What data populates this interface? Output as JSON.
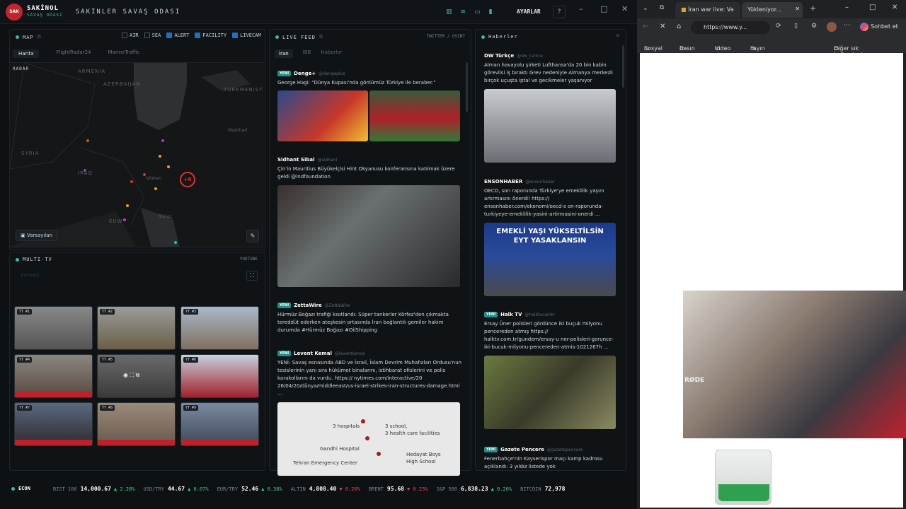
{
  "app": {
    "brand": "SAKİNOL",
    "brand_sub": "SAVAŞ ODASI",
    "logo_text": "SAKİNOL",
    "page_title": "SAKİNLER SAVAŞ ODASI",
    "settings_label": "AYARLAR",
    "help_label": "?"
  },
  "map_panel": {
    "title": "MAP",
    "filters": [
      {
        "label": "AIR",
        "checked": false
      },
      {
        "label": "SEA",
        "checked": false
      },
      {
        "label": "ALERT",
        "checked": true
      },
      {
        "label": "FACILITY",
        "checked": true
      },
      {
        "label": "LIVECAM",
        "checked": true
      }
    ],
    "tabs": [
      "Harita",
      "FlightRadar24",
      "MarineTraffic"
    ],
    "radar_label": "RADAR",
    "labels": [
      "ARMENIA",
      "AZERBAIJAN",
      "TURKMENIST",
      "SYRIA",
      "IRAQ",
      "Isfahan",
      "KUW",
      "Mashhad",
      "Shiraz"
    ],
    "marker_label": "+8",
    "preset_label": "Varsayılan"
  },
  "tv_panel": {
    "title": "MULTI-TV",
    "source": "YOUTUBE",
    "sub": "KAYNAK",
    "tiles": [
      "YT #1",
      "YT #2",
      "YT #3",
      "YT #4",
      "YT #5",
      "YT #6",
      "YT #7",
      "YT #8",
      "YT #9"
    ]
  },
  "feed_panel": {
    "title": "LIVE FEED",
    "source": "TWITTER / OSINT",
    "tabs": [
      "İran",
      "İBB",
      "Haberler"
    ],
    "posts": [
      {
        "name": "Denge+",
        "handle": "@dengeplus",
        "tag": "YENİ",
        "text": "George Hagi: \"Dünya Kupası'nda gönlümüz Türkiye ile beraber.\""
      },
      {
        "name": "Sidhant Sibal",
        "handle": "@sidhant",
        "tag": "",
        "text": "Çin'in Mauritius Büyükelçisi Hint Okyanusu konferansına katılmak üzere geldi @indfoundation"
      },
      {
        "name": "ZettaWire",
        "handle": "@ZettaWire",
        "tag": "YENİ",
        "text": "Hürmüz Boğazı trafiği kısıtlandı: Süper tankerler Körfez'den çıkmakta tereddüt ederken ateşkesin ortasında İran bağlantılı gemiler hakim durumda #Hürmüz Boğazı #OilShipping"
      },
      {
        "name": "Levent Kemal",
        "handle": "@leventkemal",
        "tag": "YENİ",
        "text": "YENİ: Savaş esnasında ABD ve İsrail, İslam Devrim Muhafızları Ordusu'nun tesislerinin yanı sıra hükümet binalarını, istihbarat ofislerini ve polis karakollarını da vurdu. https:// nytimes.com/interactive/20 26/04/20/dünya/middleeast/us-israel-strikes-iran-structures-damage.html …"
      }
    ],
    "map_image_labels": [
      "3 hospitals",
      "3 school,",
      "3 health care facilities",
      "Gandhi Hospital",
      "Hedayat Boys",
      "High School",
      "Tehran Emergency Center"
    ]
  },
  "news_panel": {
    "title": "Haberler",
    "items": [
      {
        "name": "DW Türkçe",
        "handle": "@dw_turkce",
        "tag": "",
        "text": "Alman havayolu şirketi Lufthansa'da 20 bin kabin görevlisi iş bıraktı Grev nedeniyle Almanya merkezli birçok uçuşta iptal ve gecikmeler yaşanıyor"
      },
      {
        "name": "ENSONHABER",
        "handle": "@ensonhaber",
        "tag": "",
        "text": "OECD, son raporunda Türkiye'ye emeklilik yaşını artırmasını önerdi! https:// ensonhaber.com/ekonomi/oecd-s on-raporunda-turkiyeye-emeklilik-yasini-artirmasini-onerdi …",
        "img_text": "EMEKLİ YAŞI YÜKSELTİLSİN EYT YASAKLANSIN"
      },
      {
        "name": "Halk TV",
        "handle": "@halktvcomtr",
        "tag": "YENİ",
        "text": "Ersay Üner polisleri gördünce iki buçuk milyonu pencereden atmış https:// halktv.com.tr/gundem/ersay-u ner-polisleri-gorunce-iki-bucuk-milyonu-pencereden-atmis-1021267h …"
      },
      {
        "name": "Gazete Pencere",
        "handle": "@gazetepencere",
        "tag": "YENİ",
        "text": "Fenerbahçe'nin Kayserispor maçı kamp kadrosu açıklandı: 3 yıldız listede yok"
      }
    ]
  },
  "econ": {
    "label": "ECON",
    "items": [
      {
        "name": "BIST 100",
        "value": "14,000.67",
        "chg": "▲ 2.28%",
        "dir": "up"
      },
      {
        "name": "USD/TRY",
        "value": "44.67",
        "chg": "▲ 0.07%",
        "dir": "up"
      },
      {
        "name": "EUR/TRY",
        "value": "52.46",
        "chg": "▲ 0.38%",
        "dir": "up"
      },
      {
        "name": "ALTIN",
        "value": "4,808.40",
        "chg": "▼ 0.26%",
        "dir": "dn"
      },
      {
        "name": "BRENT",
        "value": "95.68",
        "chg": "▼ 0.25%",
        "dir": "dn"
      },
      {
        "name": "S&P 500",
        "value": "6,838.23",
        "chg": "▲ 0.20%",
        "dir": "up"
      },
      {
        "name": "BITCOIN",
        "value": "72,978",
        "chg": "",
        "dir": "up"
      }
    ]
  },
  "browser": {
    "tab1": "İran war live: Va",
    "tab2": "Yükleniyor...",
    "url": "https://www.y...",
    "chat_label": "Sohbet et",
    "bookmarks": [
      "Sosyal",
      "Basın",
      "Video",
      "Yayın"
    ],
    "bookmarks_right": "Diğer sık kullanılanlar"
  },
  "webcam": {
    "mic_brand": "RØDE"
  }
}
